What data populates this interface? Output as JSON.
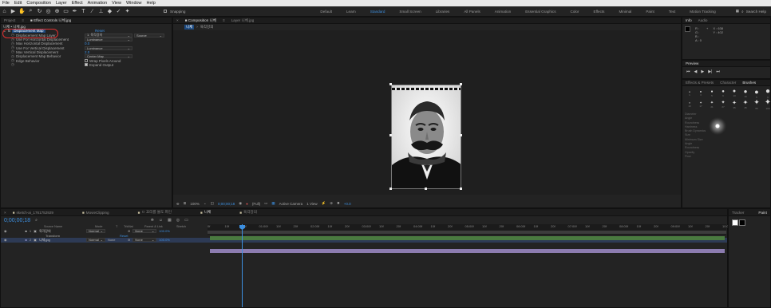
{
  "menubar": {
    "items": [
      "File",
      "Edit",
      "Composition",
      "Layer",
      "Effect",
      "Animation",
      "View",
      "Window",
      "Help"
    ]
  },
  "toolbar": {
    "snapping_label": "Snapping",
    "workspaces": [
      "Default",
      "Learn",
      "Standard",
      "Small Screen",
      "Libraries",
      "All Panels",
      "Animation",
      "Essential Graphics",
      "Color",
      "Effects",
      "Minimal",
      "Paint",
      "Text",
      "Motion Tracking"
    ],
    "active_workspace": "Standard",
    "search_placeholder": "Search Help"
  },
  "project_panel": {
    "tab_project": "Project",
    "tab_effect_controls": "Effect Controls 니체.jpg",
    "layer_path": "니체 • 니체.jpg",
    "effect_name": "Displacement Map",
    "reset_label": "Reset",
    "properties": [
      {
        "label": "Displacement Map Layer",
        "value": "1. 육각강의",
        "extra": "Source"
      },
      {
        "label": "Use For Horizontal Displacement",
        "value": "Luminance"
      },
      {
        "label": "Max Horizontal Displacement",
        "value": "0.0"
      },
      {
        "label": "Use For Vertical Displacement",
        "value": "Luminance"
      },
      {
        "label": "Max Vertical Displacement",
        "value": "2.0"
      },
      {
        "label": "Displacement Map Behavior",
        "value": "Center Map"
      },
      {
        "label": "Edge Behavior",
        "value": "Wrap Pixels Around"
      },
      {
        "label": "",
        "value": "Expand Output"
      }
    ]
  },
  "comp_panel": {
    "tab_comp": "Composition 니체",
    "tab_layer": "Layer 니체.jpg",
    "breadcrumb_a": "니체",
    "breadcrumb_b": "육각강의",
    "zoom": "100%",
    "timecode": "0;00;00;18",
    "resolution": "(Full)",
    "camera": "Active Camera",
    "views": "1 View",
    "exposure": "+0.0"
  },
  "right_panel": {
    "tab_info": "Info",
    "tab_audio": "Audio",
    "rgba": [
      "R :",
      "G :",
      "B :",
      "A : 0"
    ],
    "coords": [
      "X : 638",
      "Y : 402"
    ],
    "tab_preview": "Preview",
    "tab_effects": "Effects & Presets",
    "tab_character": "Character",
    "tab_brushes": "Brushes",
    "brush_sizes": [
      "1",
      "3",
      "5",
      "9",
      "13",
      "19",
      "5",
      "9",
      "13",
      "17",
      "21",
      "27",
      "35",
      "45",
      "65",
      "100"
    ],
    "brush_props": [
      "Diameter",
      "Angle",
      "Roundness",
      "Hardness",
      "Brush Dynamics",
      "Size",
      "Minimum Size",
      "Angle",
      "Roundness",
      "Opacity",
      "Flow"
    ],
    "tab_tracker": "Tracker",
    "tab_paint": "Paint"
  },
  "timeline": {
    "tabs": [
      "sketch-ai_1761752929",
      "MovieClipping",
      "ㅁ 꼬리를 물도 파인",
      "니체",
      "육각강의"
    ],
    "active_tab": "니체",
    "timecode": "0;00;00;18",
    "columns": [
      "Source Name",
      "Mode",
      "T",
      "TrkMat",
      "Parent & Link",
      "Stretch"
    ],
    "layers": [
      {
        "num": "1",
        "name": "육각강의",
        "mode": "Normal",
        "trkmat": "",
        "parent": "None",
        "stretch": "100.0%",
        "color": "#b0b0b0"
      },
      {
        "num": "",
        "name": "Transform",
        "reset": "Reset"
      },
      {
        "num": "2",
        "name": "니체.jpg",
        "mode": "Normal",
        "trkmat": "None",
        "parent": "None",
        "stretch": "100.0%",
        "color": "#8c8cc0"
      }
    ],
    "ruler": [
      "0f",
      "10f",
      "20f",
      "01:00f",
      "10f",
      "20f",
      "02:00f",
      "10f",
      "20f",
      "03:00f",
      "10f",
      "20f",
      "04:00f",
      "10f",
      "20f",
      "05:00f",
      "10f",
      "20f",
      "06:00f",
      "10f",
      "20f",
      "07:00f",
      "10f",
      "20f",
      "08:00f",
      "10f",
      "20f",
      "09:00f",
      "10f",
      "20f",
      "10:0"
    ]
  },
  "colors": {
    "accent": "#3c8fe0",
    "highlight": "#e03030",
    "track_green": "#4a7a40",
    "track_purple": "#8c7cb0"
  }
}
